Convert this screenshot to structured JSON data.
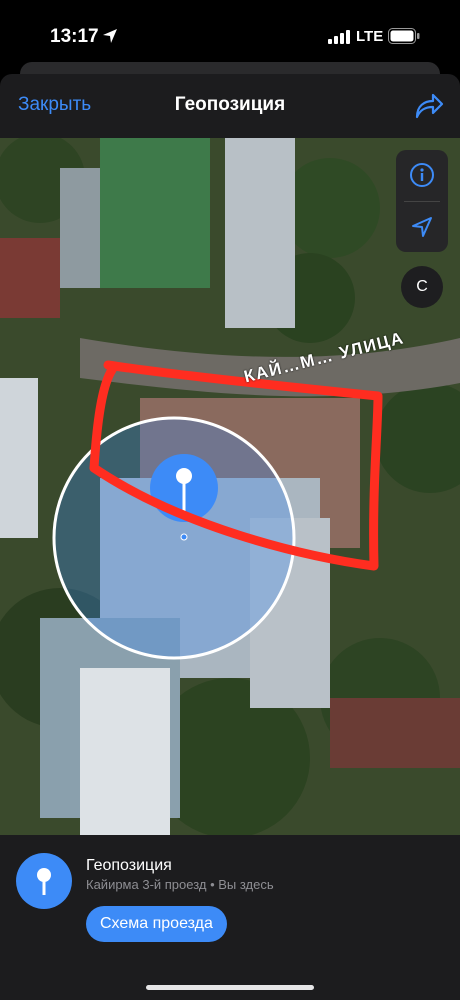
{
  "status": {
    "time": "13:17",
    "network": "LTE"
  },
  "nav": {
    "close_label": "Закрыть",
    "title": "Геопозиция"
  },
  "map": {
    "street_label": "КАЙ…М… УЛИЦА",
    "compass_label": "С"
  },
  "card": {
    "title": "Геопозиция",
    "subtitle": "Кайирма 3-й проезд • Вы здесь",
    "route_label": "Схема проезда"
  },
  "colors": {
    "accent": "#3d8bf7",
    "annotation": "#ff2d20"
  }
}
